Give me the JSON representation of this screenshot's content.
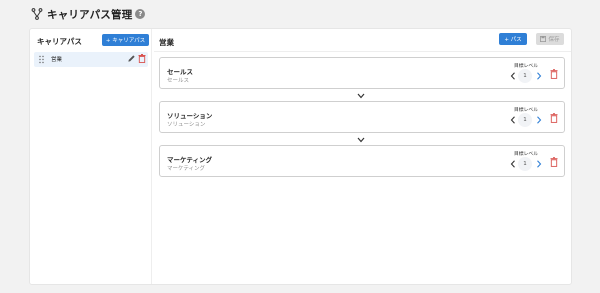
{
  "header": {
    "title": "キャリアパス管理",
    "help_glyph": "?"
  },
  "sidebar": {
    "title": "キャリアパス",
    "add_button_label": "+ キャリアパス",
    "items": [
      {
        "label": "営業"
      }
    ]
  },
  "main": {
    "title": "営業",
    "add_path_label": "+ パス",
    "save_label": "保存",
    "level_label": "目標レベル",
    "cards": [
      {
        "name": "セールス",
        "sub": "セールス",
        "level": "1"
      },
      {
        "name": "ソリューション",
        "sub": "ソリューション",
        "level": "1"
      },
      {
        "name": "マーケティング",
        "sub": "マーケティング",
        "level": "1"
      }
    ]
  },
  "colors": {
    "accent": "#2f7fd6",
    "delete": "#d9534f",
    "selected_bg": "#eaf2fb",
    "disabled_bg": "#dcdcdc"
  },
  "icons": [
    "branch-icon",
    "help-icon",
    "drag-handle-icon",
    "edit-icon",
    "trash-icon",
    "save-icon",
    "chevron-left-icon",
    "chevron-right-icon",
    "chevron-down-icon"
  ]
}
